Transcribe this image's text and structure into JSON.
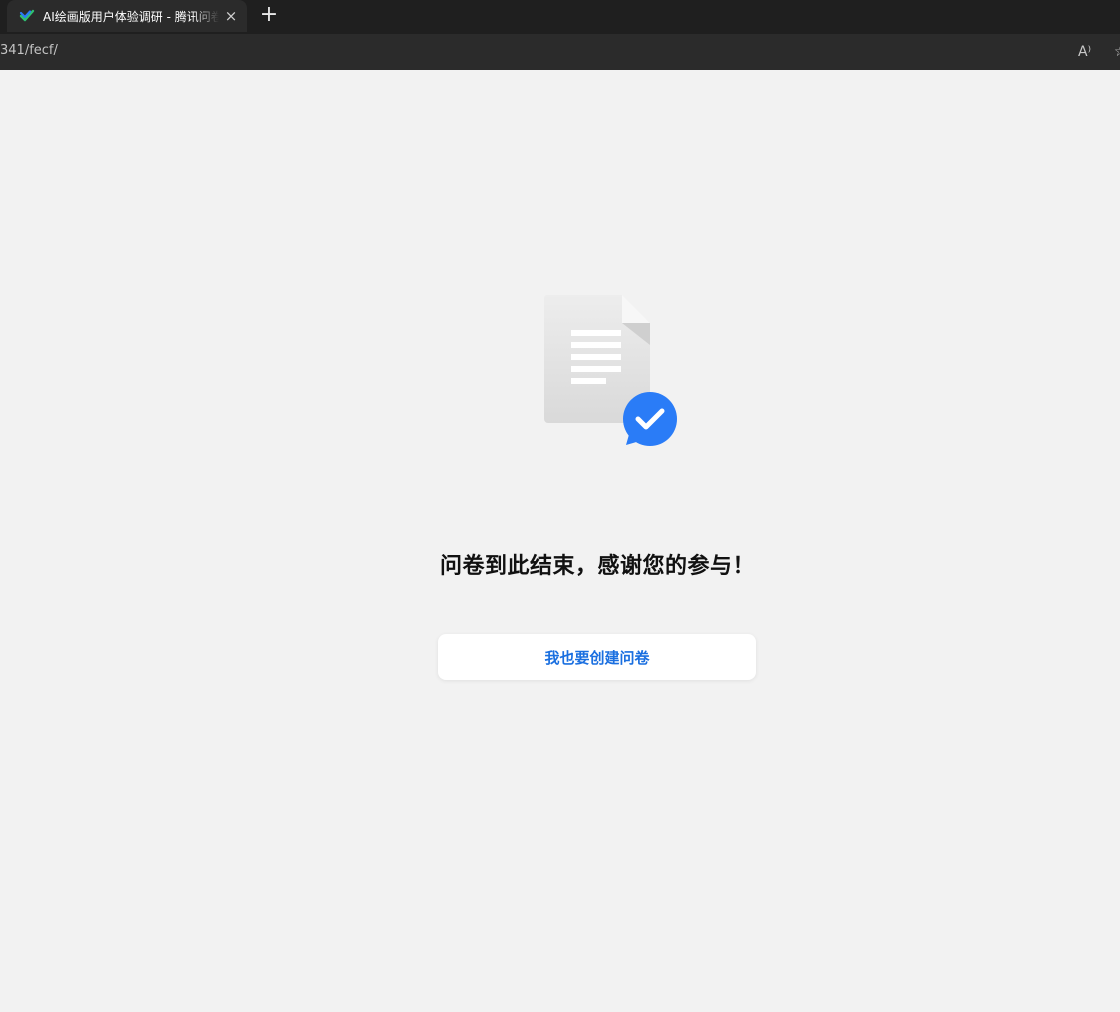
{
  "browser": {
    "tab_title": "AI绘画版用户体验调研 - 腾讯问卷",
    "tab_close": "×",
    "new_tab": "+",
    "url": "341/fecf/",
    "read_aloud_icon": "A⁾"
  },
  "page": {
    "end_message": "问卷到此结束，感谢您的参与！",
    "create_button_label": "我也要创建问卷"
  },
  "colors": {
    "accent": "#2a7cf7",
    "button_text": "#1a6fe0",
    "background": "#f2f2f2"
  }
}
